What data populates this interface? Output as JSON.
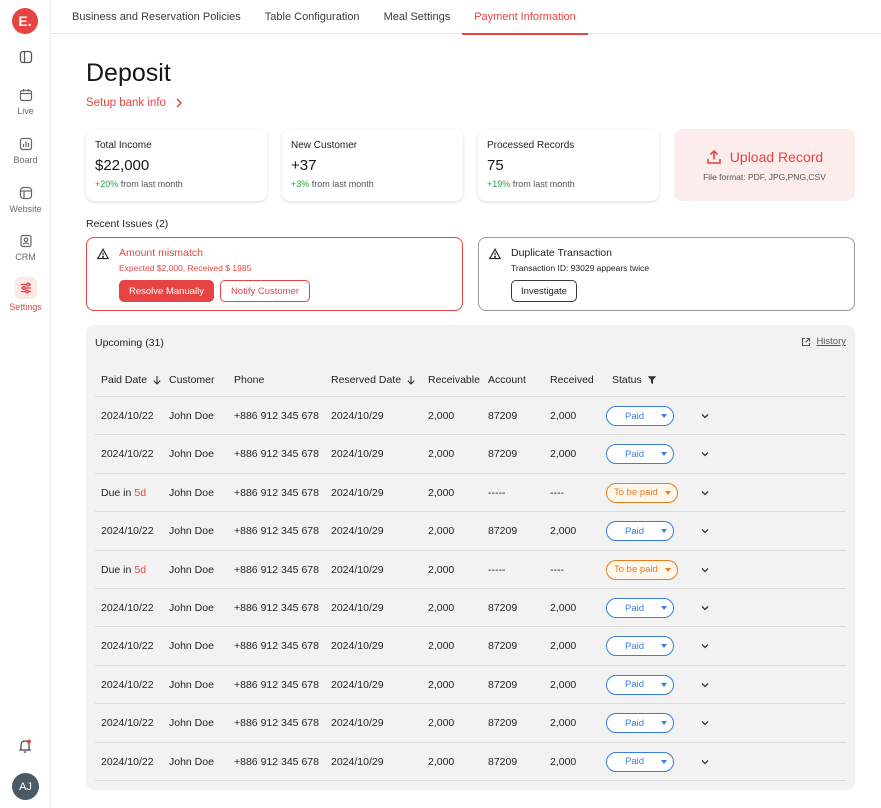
{
  "sidebar": {
    "logo": "E.",
    "items": [
      {
        "label": "",
        "icon": "panel-toggle-icon"
      },
      {
        "label": "Live",
        "icon": "calendar-icon"
      },
      {
        "label": "Board",
        "icon": "chart-icon"
      },
      {
        "label": "Website",
        "icon": "browser-icon"
      },
      {
        "label": "CRM",
        "icon": "contact-icon"
      },
      {
        "label": "Settings",
        "icon": "sliders-icon"
      }
    ],
    "avatar": "AJ"
  },
  "tabs": [
    {
      "label": "Business and Reservation Policies"
    },
    {
      "label": "Table Configuration"
    },
    {
      "label": "Meal Settings"
    },
    {
      "label": "Payment Information"
    }
  ],
  "page": {
    "title": "Deposit",
    "bank_link": "Setup bank info"
  },
  "stats": [
    {
      "label": "Total Income",
      "value": "$22,000",
      "change": "+20%",
      "change_suffix": " from last month"
    },
    {
      "label": "New Customer",
      "value": "+37",
      "change": "+3%",
      "change_suffix": " from last month"
    },
    {
      "label": "Processed Records",
      "value": "75",
      "change": "+19%",
      "change_suffix": " from last month"
    }
  ],
  "upload": {
    "label": "Upload Record",
    "formats": "File format: PDF, JPG,PNG,CSV"
  },
  "issues": {
    "label": "Recent Issues (2)",
    "items": [
      {
        "title": "Amount mismatch",
        "desc": "Expected $2,000, Received $ 1985",
        "buttons": [
          "Resolve Manually",
          "Notify Customer"
        ]
      },
      {
        "title": "Duplicate Transaction",
        "desc": "Transaction ID: 93029 appears twice",
        "buttons": [
          "Investigate"
        ]
      }
    ]
  },
  "table": {
    "title": "Upcoming (31)",
    "history": "History",
    "columns": [
      "Paid Date",
      "Customer",
      "Phone",
      "Reserved Date",
      "Receivable",
      "Account",
      "Received",
      "Status"
    ],
    "rows": [
      {
        "paid_date": "2024/10/22",
        "due": "",
        "customer": "John Doe",
        "phone": "+886 912 345 678",
        "reserved": "2024/10/29",
        "receivable": "2,000",
        "account": "87209",
        "received": "2,000",
        "status": "Paid"
      },
      {
        "paid_date": "2024/10/22",
        "due": "",
        "customer": "John Doe",
        "phone": "+886 912 345 678",
        "reserved": "2024/10/29",
        "receivable": "2,000",
        "account": "87209",
        "received": "2,000",
        "status": "Paid"
      },
      {
        "paid_date": "Due in",
        "due": "5d",
        "customer": "John Doe",
        "phone": "+886 912 345 678",
        "reserved": "2024/10/29",
        "receivable": "2,000",
        "account": "-----",
        "received": "----",
        "status": "To be paid"
      },
      {
        "paid_date": "2024/10/22",
        "due": "",
        "customer": "John Doe",
        "phone": "+886 912 345 678",
        "reserved": "2024/10/29",
        "receivable": "2,000",
        "account": "87209",
        "received": "2,000",
        "status": "Paid"
      },
      {
        "paid_date": "Due in",
        "due": "5d",
        "customer": "John Doe",
        "phone": "+886 912 345 678",
        "reserved": "2024/10/29",
        "receivable": "2,000",
        "account": "-----",
        "received": "----",
        "status": "To be paid"
      },
      {
        "paid_date": "2024/10/22",
        "due": "",
        "customer": "John Doe",
        "phone": "+886 912 345 678",
        "reserved": "2024/10/29",
        "receivable": "2,000",
        "account": "87209",
        "received": "2,000",
        "status": "Paid"
      },
      {
        "paid_date": "2024/10/22",
        "due": "",
        "customer": "John Doe",
        "phone": "+886 912 345 678",
        "reserved": "2024/10/29",
        "receivable": "2,000",
        "account": "87209",
        "received": "2,000",
        "status": "Paid"
      },
      {
        "paid_date": "2024/10/22",
        "due": "",
        "customer": "John Doe",
        "phone": "+886 912 345 678",
        "reserved": "2024/10/29",
        "receivable": "2,000",
        "account": "87209",
        "received": "2,000",
        "status": "Paid"
      },
      {
        "paid_date": "2024/10/22",
        "due": "",
        "customer": "John Doe",
        "phone": "+886 912 345 678",
        "reserved": "2024/10/29",
        "receivable": "2,000",
        "account": "87209",
        "received": "2,000",
        "status": "Paid"
      },
      {
        "paid_date": "2024/10/22",
        "due": "",
        "customer": "John Doe",
        "phone": "+886 912 345 678",
        "reserved": "2024/10/29",
        "receivable": "2,000",
        "account": "87209",
        "received": "2,000",
        "status": "Paid"
      }
    ]
  },
  "colors": {
    "accent": "#e84343",
    "paid": "#3b7ddd",
    "pending": "#e67e22",
    "positive": "#24a148"
  }
}
